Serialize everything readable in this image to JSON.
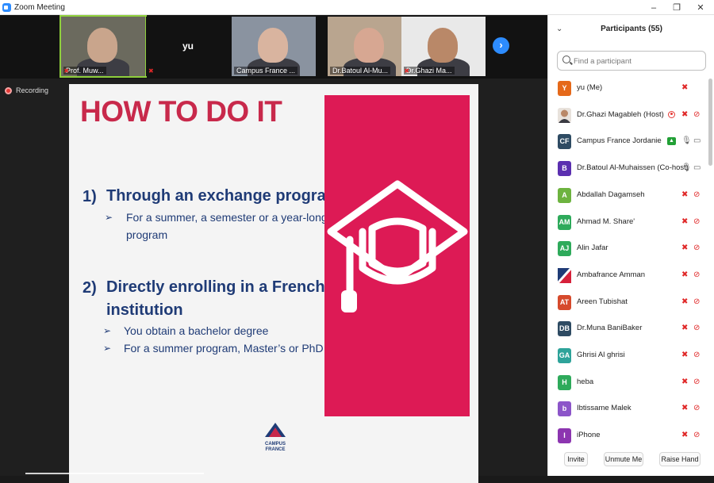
{
  "window": {
    "title": "Zoom Meeting",
    "controls": [
      "–",
      "❐",
      "✕"
    ]
  },
  "thumbnails": [
    {
      "label": "Prof. Muw...",
      "muted": true,
      "active": true,
      "skin": "#c9a58c",
      "bg": "#6b6a5e"
    },
    {
      "label": "yu",
      "muted": true,
      "nameOnly": true
    },
    {
      "label": "Campus France ...",
      "muted": false,
      "skin": "#d9b49f",
      "bg": "#8a93a0"
    },
    {
      "label": "Dr.Batoul Al-Mu...",
      "muted": false,
      "skin": "#d7a792",
      "bg": "#b9a58f"
    },
    {
      "label": "Dr.Ghazi Ma...",
      "muted": true,
      "skin": "#b98868",
      "bg": "#e9e9e9"
    }
  ],
  "next_page_icon": "chevron-right-icon",
  "recording_label": "Recording",
  "slide": {
    "title": "HOW TO DO IT",
    "items": [
      {
        "num": "1)",
        "text": [
          "Through an exchange program"
        ],
        "bullets": [
          [
            "For a summer, a semester or a year-long",
            "program"
          ]
        ]
      },
      {
        "num": "2)",
        "text": [
          "Directly enrolling in a French",
          "institution"
        ],
        "bullets": [
          [
            "You obtain a bachelor degree"
          ],
          [
            "For a summer program, Master’s or PhD"
          ]
        ]
      }
    ],
    "logo_text": [
      "CAMPUS",
      "FRANCE"
    ],
    "graphic_icon": "graduation-cap-icon",
    "colors": {
      "title": "#c8294b",
      "text": "#1f3b76",
      "panel": "#dd1a55"
    }
  },
  "participants_panel": {
    "title": "Participants (55)",
    "search_placeholder": "Find a participant",
    "participants": [
      {
        "name": "yu (Me)",
        "initials": "Y",
        "color": "#e5691a",
        "mic": "off",
        "video": "none"
      },
      {
        "name": "Dr.Ghazi Magableh (Host)",
        "initials": "",
        "color": "#b98868",
        "photo": true,
        "mic": "off",
        "video": "off",
        "recording": true
      },
      {
        "name": "Campus France Jordanie",
        "initials": "CF",
        "color": "#2e4b63",
        "mic": "on",
        "video": "on",
        "sharing": true
      },
      {
        "name": "Dr.Batoul Al-Muhaissen (Co-host)",
        "initials": "B",
        "color": "#5b2fb0",
        "mic": "on",
        "video": "on"
      },
      {
        "name": "Abdallah Dagamseh",
        "initials": "A",
        "color": "#6db33f",
        "mic": "off",
        "video": "off"
      },
      {
        "name": "Ahmad M. Share'",
        "initials": "AM",
        "color": "#2eaa5b",
        "mic": "off",
        "video": "off"
      },
      {
        "name": "Alin Jafar",
        "initials": "AJ",
        "color": "#2eaa5b",
        "mic": "off",
        "video": "off"
      },
      {
        "name": "Ambafrance Amman",
        "initials": "",
        "color": "#1f3b76",
        "flag": true,
        "mic": "off",
        "video": "off"
      },
      {
        "name": "Areen Tubishat",
        "initials": "AT",
        "color": "#d64a2c",
        "mic": "off",
        "video": "off"
      },
      {
        "name": "Dr.Muna BaniBaker",
        "initials": "DB",
        "color": "#2e4b63",
        "mic": "off",
        "video": "off"
      },
      {
        "name": "Ghrisi Al ghrisi",
        "initials": "GA",
        "color": "#2ea39a",
        "mic": "off",
        "video": "off"
      },
      {
        "name": "heba",
        "initials": "H",
        "color": "#2eaa5b",
        "mic": "off",
        "video": "off"
      },
      {
        "name": "Ibtissame Malek",
        "initials": "b",
        "color": "#8c55c9",
        "mic": "off",
        "video": "off"
      },
      {
        "name": "iPhone",
        "initials": "I",
        "color": "#8c35b0",
        "mic": "off",
        "video": "off"
      }
    ],
    "footer_buttons": [
      "Invite",
      "Unmute Me",
      "Raise Hand"
    ]
  }
}
